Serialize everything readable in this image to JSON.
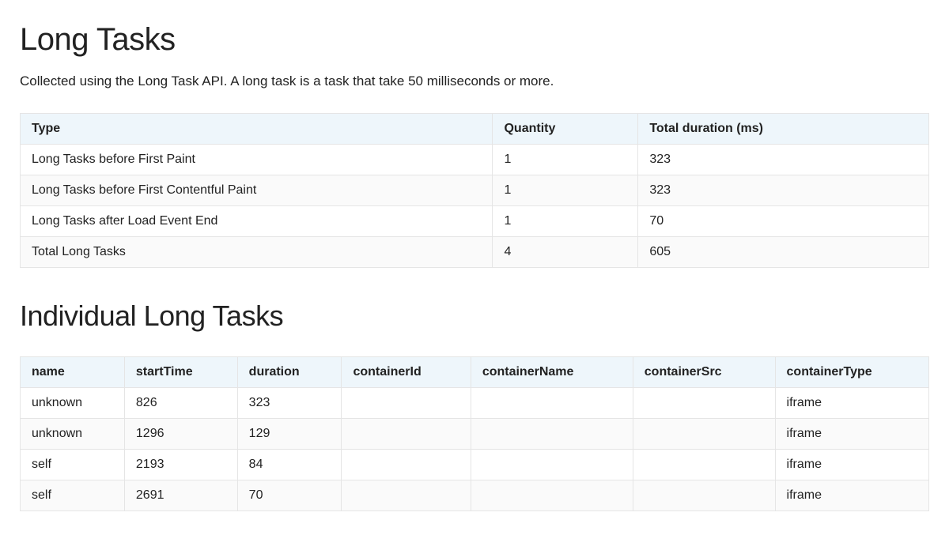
{
  "summary": {
    "heading": "Long Tasks",
    "description": "Collected using the Long Task API. A long task is a task that take 50 milliseconds or more.",
    "columns": [
      "Type",
      "Quantity",
      "Total duration (ms)"
    ],
    "rows": [
      {
        "type": "Long Tasks before First Paint",
        "quantity": "1",
        "duration": "323"
      },
      {
        "type": "Long Tasks before First Contentful Paint",
        "quantity": "1",
        "duration": "323"
      },
      {
        "type": "Long Tasks after Load Event End",
        "quantity": "1",
        "duration": "70"
      },
      {
        "type": "Total Long Tasks",
        "quantity": "4",
        "duration": "605"
      }
    ]
  },
  "individual": {
    "heading": "Individual Long Tasks",
    "columns": [
      "name",
      "startTime",
      "duration",
      "containerId",
      "containerName",
      "containerSrc",
      "containerType"
    ],
    "rows": [
      {
        "name": "unknown",
        "startTime": "826",
        "duration": "323",
        "containerId": "",
        "containerName": "",
        "containerSrc": "",
        "containerType": "iframe"
      },
      {
        "name": "unknown",
        "startTime": "1296",
        "duration": "129",
        "containerId": "",
        "containerName": "",
        "containerSrc": "",
        "containerType": "iframe"
      },
      {
        "name": "self",
        "startTime": "2193",
        "duration": "84",
        "containerId": "",
        "containerName": "",
        "containerSrc": "",
        "containerType": "iframe"
      },
      {
        "name": "self",
        "startTime": "2691",
        "duration": "70",
        "containerId": "",
        "containerName": "",
        "containerSrc": "",
        "containerType": "iframe"
      }
    ]
  }
}
